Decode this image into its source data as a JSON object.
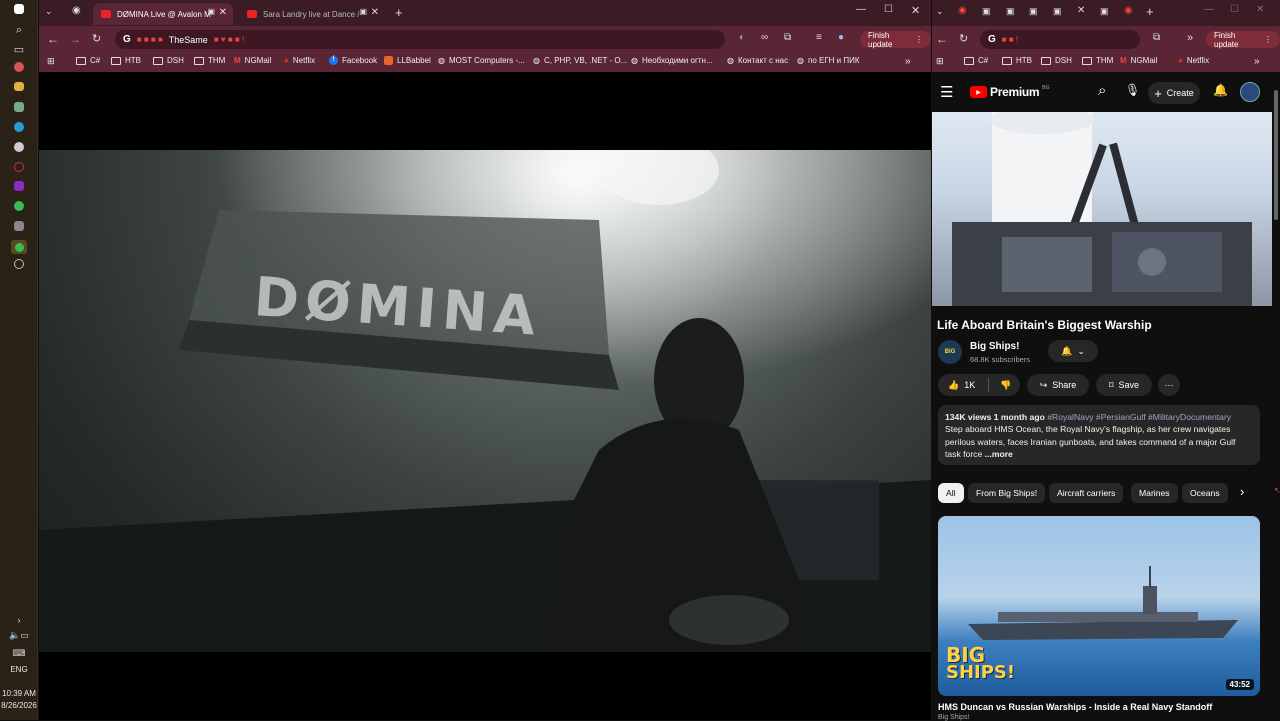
{
  "taskbar": {
    "time": "10:39 AM",
    "date": "8/26/2026",
    "lang": "ENG"
  },
  "left_browser": {
    "tabs": [
      {
        "title": "DØMINA Live @ Avalon M"
      },
      {
        "title": "Sara Landry live at Dance /"
      }
    ],
    "omnibox": "TheSame",
    "finish_update": "Finish update",
    "bookmarks": [
      "C#",
      "HTB",
      "DSH",
      "THM",
      "NGMail",
      "Netflix",
      "Facebook",
      "LLBabbel",
      "MOST Computers -...",
      "C, PHP, VB, .NET - O...",
      "Необходими огтн...",
      "Контакт с нас",
      "по ЕГН и ПИК"
    ],
    "video_overlay_text": "DØMINA"
  },
  "right_browser": {
    "omnibox": "",
    "finish_update": "Finish update",
    "bookmarks": [
      "C#",
      "HTB",
      "DSH",
      "THM",
      "NGMail",
      "Netflix"
    ],
    "youtube": {
      "logo_text": "Premium",
      "logo_badge": "BG",
      "create_label": "Create",
      "video_title": "Life Aboard Britain's Biggest Warship",
      "channel_name": "Big Ships!",
      "subscribers": "68.8K subscribers",
      "likes": "1K",
      "share_label": "Share",
      "save_label": "Save",
      "views": "134K views",
      "age": "1 month ago",
      "hashtags": "#RoyalNavy #PersianGulf #MilitaryDocumentary",
      "description": "Step aboard HMS Ocean, the Royal Navy's flagship, as her crew navigates perilous waters, faces Iranian gunboats, and takes command of a major Gulf task force",
      "more_label": "...more",
      "chips": [
        "All",
        "From Big Ships!",
        "Aircraft carriers",
        "Marines",
        "Oceans"
      ],
      "next_video": {
        "title": "HMS Duncan vs Russian Warships - Inside a Real Navy Standoff",
        "channel": "Big Ships!",
        "duration": "43:52",
        "logo_line1": "BIG",
        "logo_line2": "SHIPS!"
      }
    }
  }
}
